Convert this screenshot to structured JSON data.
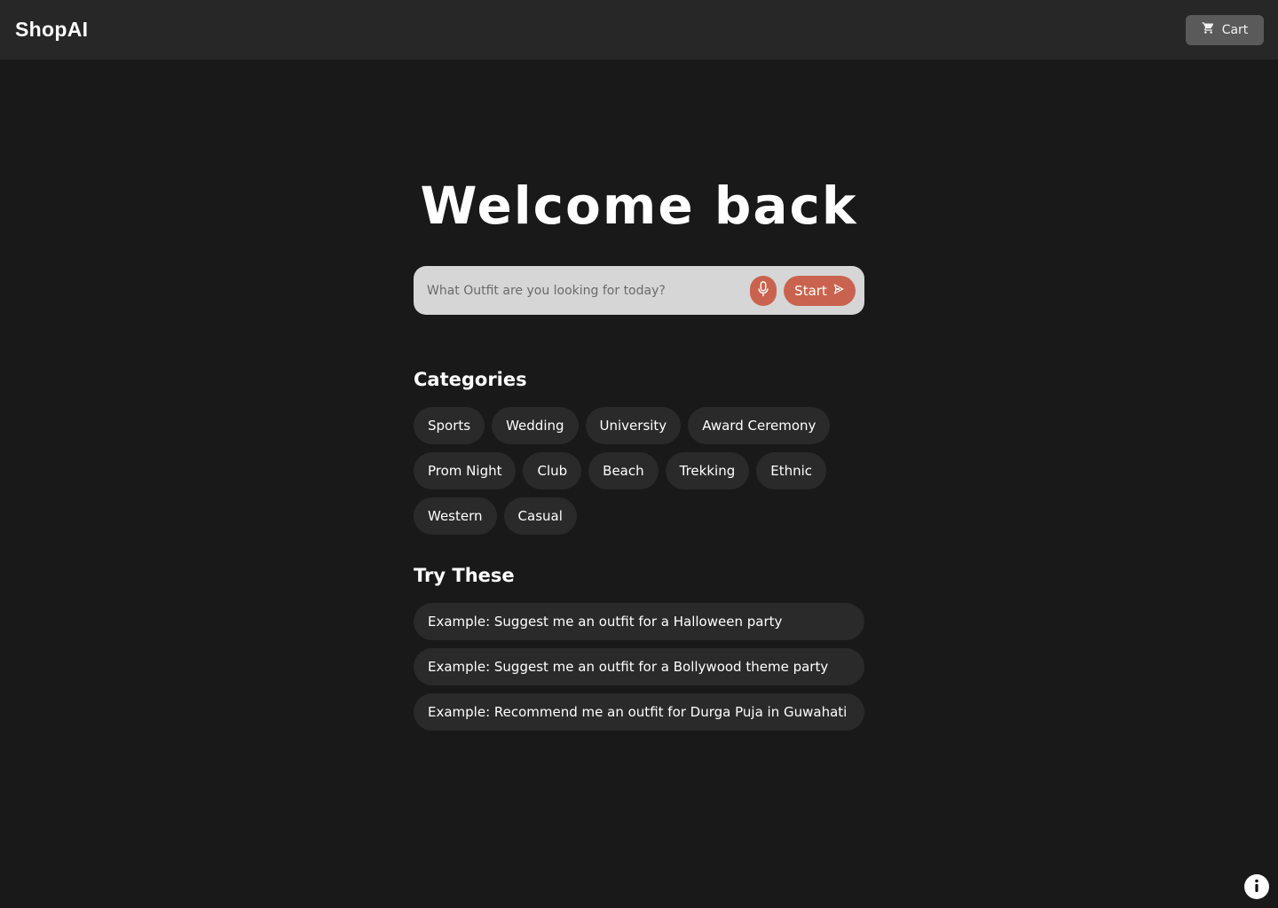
{
  "header": {
    "brand": "ShopAI",
    "cart_label": "Cart",
    "cart_icon": "cart-icon"
  },
  "hero": {
    "title": "Welcome back"
  },
  "search": {
    "placeholder": "What Outfit are you looking for today?",
    "value": "",
    "mic_icon": "microphone-icon",
    "start_label": "Start",
    "start_icon": "send-arrow-icon"
  },
  "categories": {
    "title": "Categories",
    "items": [
      {
        "label": "Sports"
      },
      {
        "label": "Wedding"
      },
      {
        "label": "University"
      },
      {
        "label": "Award Ceremony"
      },
      {
        "label": "Prom Night"
      },
      {
        "label": "Club"
      },
      {
        "label": "Beach"
      },
      {
        "label": "Trekking"
      },
      {
        "label": "Ethnic"
      },
      {
        "label": "Western"
      },
      {
        "label": "Casual"
      }
    ]
  },
  "try_these": {
    "title": "Try These",
    "items": [
      {
        "label": "Example: Suggest me an outfit for a Halloween party"
      },
      {
        "label": "Example: Suggest me an outfit for a Bollywood theme party"
      },
      {
        "label": "Example: Recommend me an outfit for Durga Puja in Guwahati"
      }
    ]
  },
  "info_icon": "info-icon",
  "colors": {
    "background": "#191919",
    "topbar": "#272727",
    "accent": "#c9634f",
    "chip": "#2a2a2a",
    "search_bg": "#d6d6d6",
    "cart_button": "#5a5a5a"
  }
}
